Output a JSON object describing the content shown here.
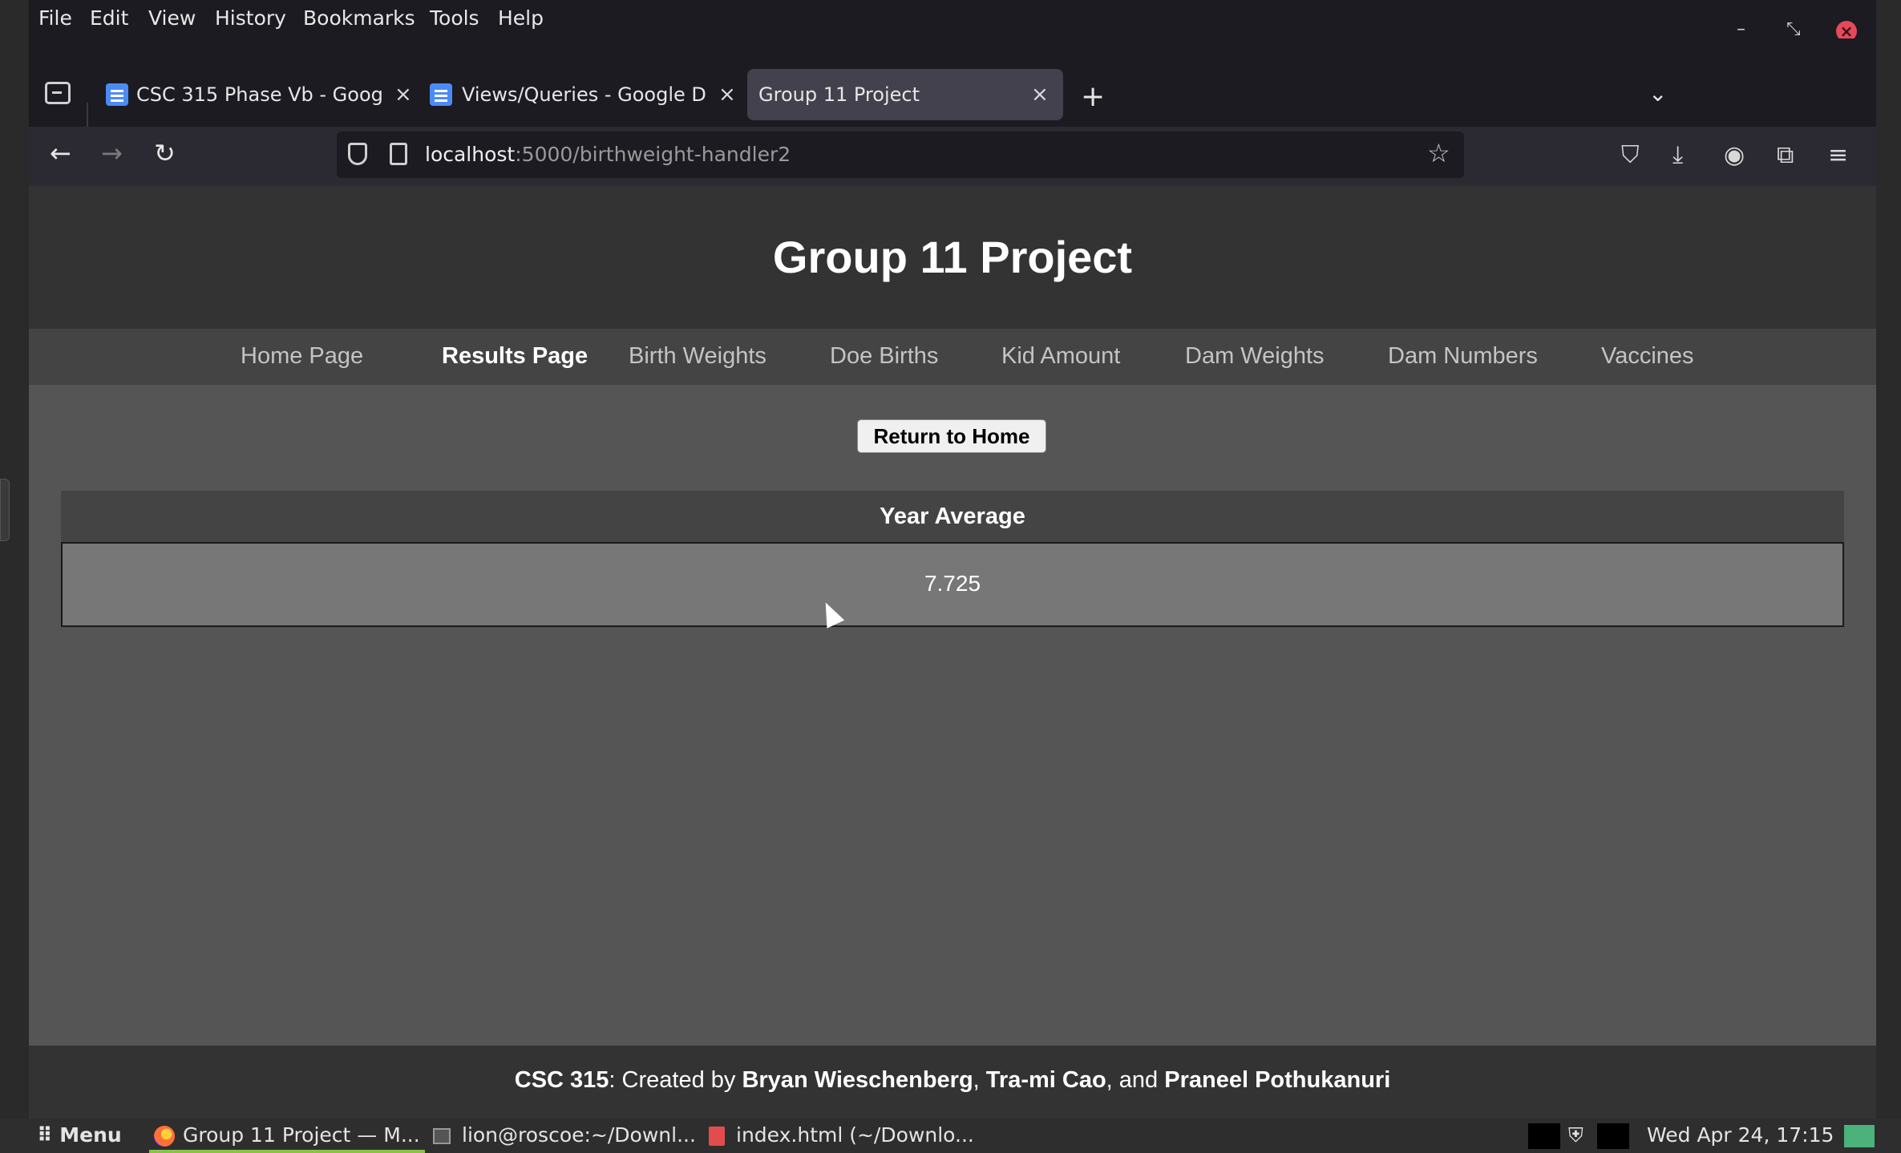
{
  "menubar": {
    "items": [
      "File",
      "Edit",
      "View",
      "History",
      "Bookmarks",
      "Tools",
      "Help"
    ],
    "mnemonics": [
      "F",
      "E",
      "V",
      "s",
      "B",
      "T",
      "H"
    ]
  },
  "tabs": [
    {
      "title": "CSC 315 Phase Vb - Goog",
      "icon": "google-docs-icon",
      "active": false
    },
    {
      "title": "Views/Queries - Google D",
      "icon": "google-docs-icon",
      "active": false
    },
    {
      "title": "Group 11 Project",
      "icon": null,
      "active": true
    }
  ],
  "urlbar": {
    "host": "localhost",
    "path": ":5000/birthweight-handler2"
  },
  "page": {
    "title": "Group 11 Project",
    "nav": [
      "Home Page",
      "Results Page",
      "Birth Weights",
      "Doe Births",
      "Kid Amount",
      "Dam Weights",
      "Dam Numbers",
      "Vaccines"
    ],
    "active_nav": "Results Page",
    "return_button": "Return to Home",
    "table": {
      "header": "Year Average",
      "value": "7.725"
    },
    "footer": {
      "course": "CSC 315",
      "created_by": ": Created by ",
      "author1": "Bryan Wieschenberg",
      "sep1": ", ",
      "author2": "Tra-mi Cao",
      "sep2": ", and ",
      "author3": "Praneel Pothukanuri"
    }
  },
  "taskbar": {
    "menu": "Menu",
    "tasks": [
      "Group 11 Project — M...",
      "lion@roscoe:~/Downl...",
      "index.html (~/Downlo..."
    ],
    "clock": "Wed Apr 24, 17:15"
  },
  "colors": {
    "page_bg": "#555555",
    "header_bg": "#333333",
    "nav_bg": "#444444",
    "cell_bg": "#777777",
    "close_red": "#e5495a"
  }
}
